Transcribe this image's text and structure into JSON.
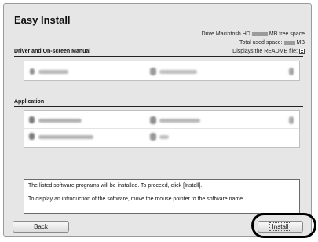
{
  "window": {
    "title": "Easy Install"
  },
  "header": {
    "drive_label": "Drive Macintosh HD",
    "free_space_suffix": "MB free space",
    "used_space_label": "Total used space:",
    "used_space_suffix": "MB",
    "readme_label": "Displays the README file:"
  },
  "sections": {
    "driver_label": "Driver and On-screen Manual",
    "application_label": "Application"
  },
  "description": {
    "line1": "The listed software programs will be installed. To proceed, click [Install].",
    "line2": "To display an introduction of the software, move the mouse pointer to the software name."
  },
  "buttons": {
    "back": "Back",
    "install": "Install"
  },
  "icons": {
    "readme": "readme-file-icon"
  }
}
